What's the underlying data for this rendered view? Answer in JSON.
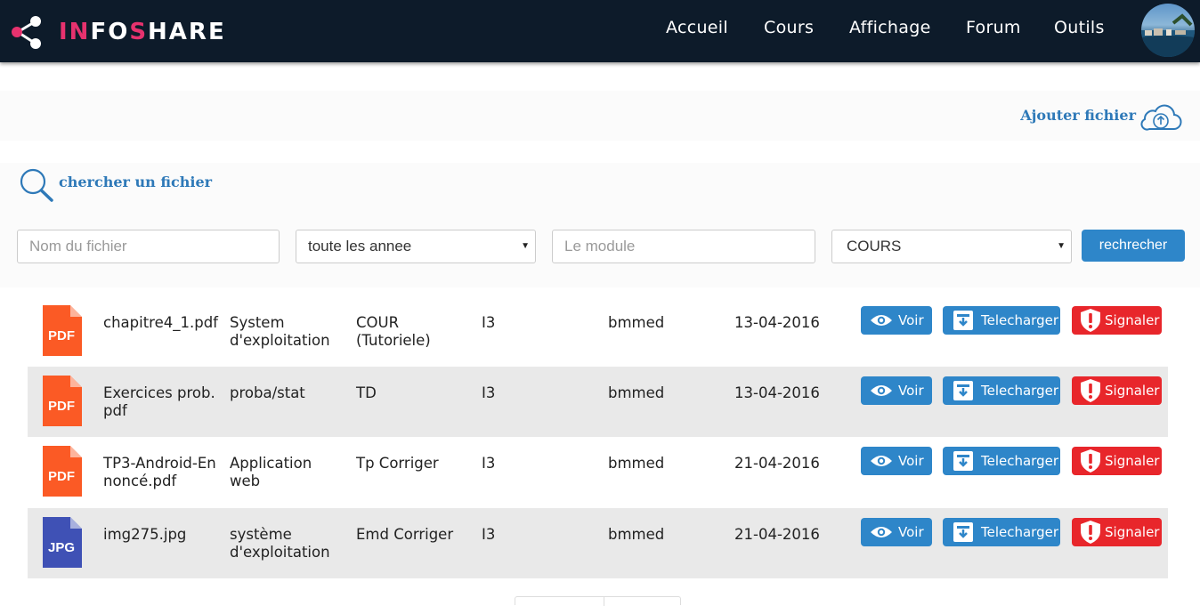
{
  "brand": {
    "prefix": "IN",
    "middle": "FO",
    "sep": "S",
    "rest": "HARE",
    "accent": "#e6326e"
  },
  "nav": {
    "items": [
      {
        "label": "Accueil"
      },
      {
        "label": "Cours"
      },
      {
        "label": "Affichage"
      },
      {
        "label": "Forum"
      },
      {
        "label": "Outils"
      }
    ]
  },
  "upload": {
    "label": "Ajouter fichier",
    "icon": "cloud-upload-icon"
  },
  "search": {
    "title": "chercher un fichier",
    "icon": "magnifier-icon",
    "filename_placeholder": "Nom du fichier",
    "year_selected": "toute les annee",
    "module_placeholder": "Le module",
    "category_selected": "COURS",
    "button_label": "rechrecher"
  },
  "files": [
    {
      "icon_label": "PDF",
      "icon_color": "#fb5a25",
      "name": "chapitre4_1.pdf",
      "module": "System d'exploitation",
      "type": "COUR (Tutoriele)",
      "year": "I3",
      "user": "bmmed",
      "date": "13-04-2016"
    },
    {
      "icon_label": "PDF",
      "icon_color": "#fb5a25",
      "name": "Exercices prob.pdf",
      "module": "proba/stat",
      "type": "TD",
      "year": "I3",
      "user": "bmmed",
      "date": "13-04-2016"
    },
    {
      "icon_label": "PDF",
      "icon_color": "#fb5a25",
      "name": "TP3-Android-Ennoncé.pdf",
      "module": "Application web",
      "type": "Tp Corriger",
      "year": "I3",
      "user": "bmmed",
      "date": "21-04-2016"
    },
    {
      "icon_label": "JPG",
      "icon_color": "#3f51b5",
      "name": "img275.jpg",
      "module": "système d'exploitation",
      "type": "Emd Corriger",
      "year": "I3",
      "user": "bmmed",
      "date": "21-04-2016"
    }
  ],
  "actions": {
    "view": "Voir",
    "download": "Telecharger",
    "report": "Signaler"
  },
  "colors": {
    "primary": "#2e86c9",
    "danger": "#e8262b",
    "navbar": "#0d1b2a"
  }
}
